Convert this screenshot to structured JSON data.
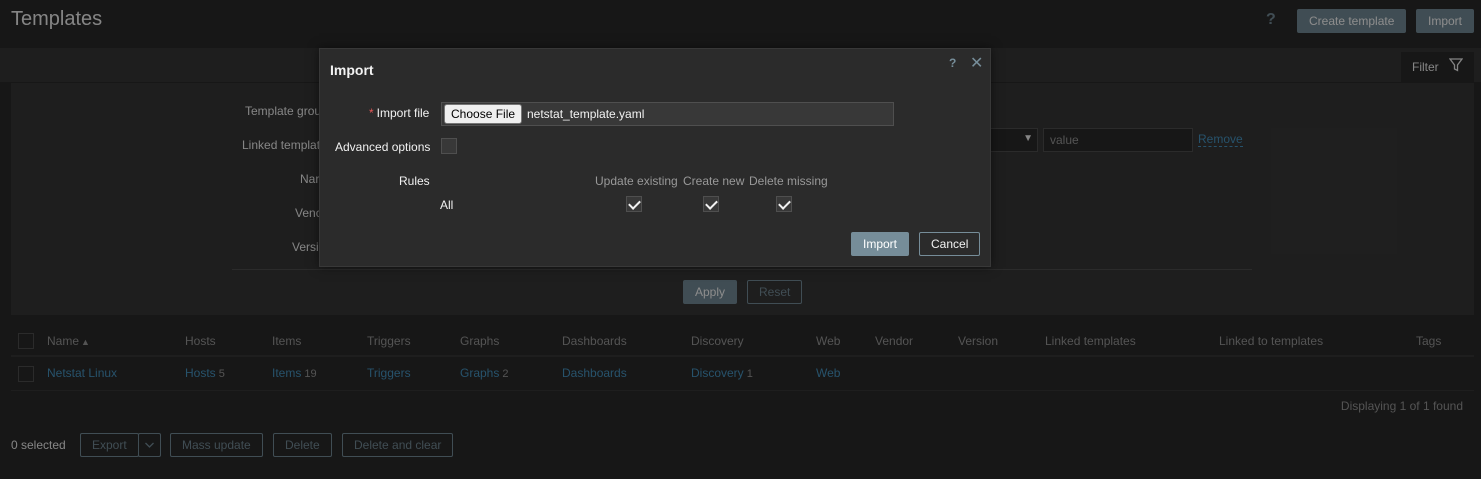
{
  "page": {
    "title": "Templates",
    "help": "?",
    "create_label": "Create template",
    "import_label": "Import"
  },
  "filter": {
    "tab_label": "Filter",
    "labels": {
      "template_groups": "Template grou",
      "linked_templates": "Linked templat",
      "name": "Nar",
      "vendor": "Venc",
      "version": "Versi"
    },
    "tag_value_placeholder": "value",
    "remove_label": "Remove",
    "apply_label": "Apply",
    "reset_label": "Reset"
  },
  "table": {
    "headers": {
      "name": "Name",
      "sort_indicator": "▲",
      "hosts": "Hosts",
      "items": "Items",
      "triggers": "Triggers",
      "graphs": "Graphs",
      "dashboards": "Dashboards",
      "discovery": "Discovery",
      "web": "Web",
      "vendor": "Vendor",
      "version": "Version",
      "linked_templates": "Linked templates",
      "linked_to_templates": "Linked to templates",
      "tags": "Tags"
    },
    "rows": [
      {
        "name": "Netstat Linux",
        "hosts": "Hosts",
        "hosts_count": "5",
        "items": "Items",
        "items_count": "19",
        "triggers": "Triggers",
        "graphs": "Graphs",
        "graphs_count": "2",
        "dashboards": "Dashboards",
        "discovery": "Discovery",
        "discovery_count": "1",
        "web": "Web"
      }
    ],
    "found_text": "Displaying 1 of 1 found"
  },
  "footer": {
    "selected_text": "0 selected",
    "export_label": "Export",
    "mass_update_label": "Mass update",
    "delete_label": "Delete",
    "delete_clear_label": "Delete and clear"
  },
  "modal": {
    "title": "Import",
    "help": "?",
    "close": "✕",
    "import_file_label": "Import file",
    "choose_file_label": "Choose File",
    "file_name": "netstat_template.yaml",
    "advanced_label": "Advanced options",
    "advanced_checked": false,
    "rules_label": "Rules",
    "rule_columns": [
      "Update existing",
      "Create new",
      "Delete missing"
    ],
    "rule_row_label": "All",
    "rule_row_checked": [
      true,
      true,
      true
    ],
    "import_label": "Import",
    "cancel_label": "Cancel"
  },
  "colors": {
    "accent": "#768d99",
    "link": "#4796c4",
    "required": "#e45959"
  }
}
